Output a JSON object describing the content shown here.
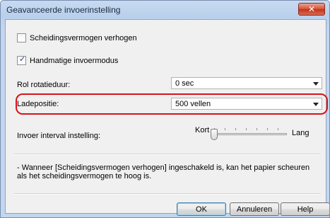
{
  "window": {
    "title": "Geavanceerde invoerinstelling",
    "close_glyph": "✕"
  },
  "checkboxes": [
    {
      "label": "Scheidingsvermogen verhogen",
      "checked": false
    },
    {
      "label": "Handmatige invoermodus",
      "checked": true
    }
  ],
  "rotation": {
    "label": "Rol rotatieduur:",
    "value": "0 sec"
  },
  "tray": {
    "label": "Ladepositie:",
    "value": "500 vellen"
  },
  "interval": {
    "label": "Invoer interval instelling:",
    "min_label": "Kort",
    "max_label": "Lang",
    "position": 0
  },
  "note": "- Wanneer [Scheidingsvermogen verhogen] ingeschakeld is, kan het papier scheuren als het scheidingsvermogen te hoog is.",
  "buttons": {
    "ok": "OK",
    "cancel": "Annuleren",
    "help": "Help"
  },
  "colors": {
    "highlight": "#d8141a",
    "close": "#c2321b",
    "checkmark": "#1f3f9a"
  }
}
